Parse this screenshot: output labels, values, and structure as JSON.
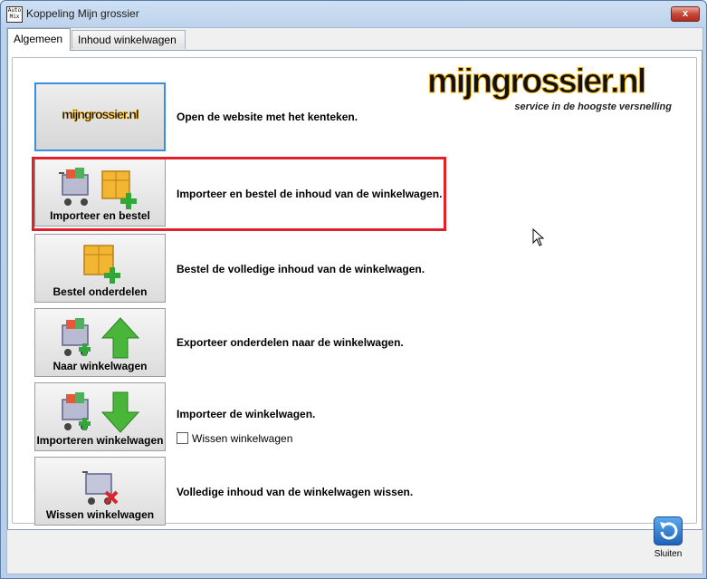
{
  "window": {
    "title": "Koppeling Mijn grossier",
    "app_icon_text": "Auto\nMix",
    "close_label": "x"
  },
  "tabs": [
    {
      "label": "Algemeen",
      "active": true
    },
    {
      "label": "Inhoud winkelwagen",
      "active": false
    }
  ],
  "logo": {
    "brand": "mijngrossier.nl",
    "tagline": "service in de hoogste versnelling"
  },
  "actions": [
    {
      "label": "",
      "logo_text": "mijngrossier.nl",
      "description": "Open de website met het kenteken.",
      "icon": "mijngrossier-logo-icon"
    },
    {
      "label": "Importeer en bestel",
      "description": "Importeer en bestel de inhoud van de winkelwagen.",
      "icon": "cart-and-box-add-icon"
    },
    {
      "label": "Bestel onderdelen",
      "description": "Bestel de volledige inhoud van de winkelwagen.",
      "icon": "box-add-icon"
    },
    {
      "label": "Naar winkelwagen",
      "description": "Exporteer onderdelen naar de winkelwagen.",
      "icon": "cart-arrow-up-icon"
    },
    {
      "label": "Importeren winkelwagen",
      "description": "Importeer de winkelwagen.",
      "icon": "cart-arrow-down-icon"
    },
    {
      "label": "Wissen winkelwagen",
      "description": "Volledige inhoud van de winkelwagen wissen.",
      "icon": "cart-delete-icon"
    }
  ],
  "checkbox": {
    "label": "Wissen winkelwagen",
    "checked": false
  },
  "footer": {
    "close_button_label": "Sluiten"
  },
  "colors": {
    "highlight": "#e0202b",
    "focus": "#3c8edc",
    "brand_yellow": "#f7b500",
    "plus_green": "#2fa83a",
    "arrow_green": "#49b63a"
  }
}
